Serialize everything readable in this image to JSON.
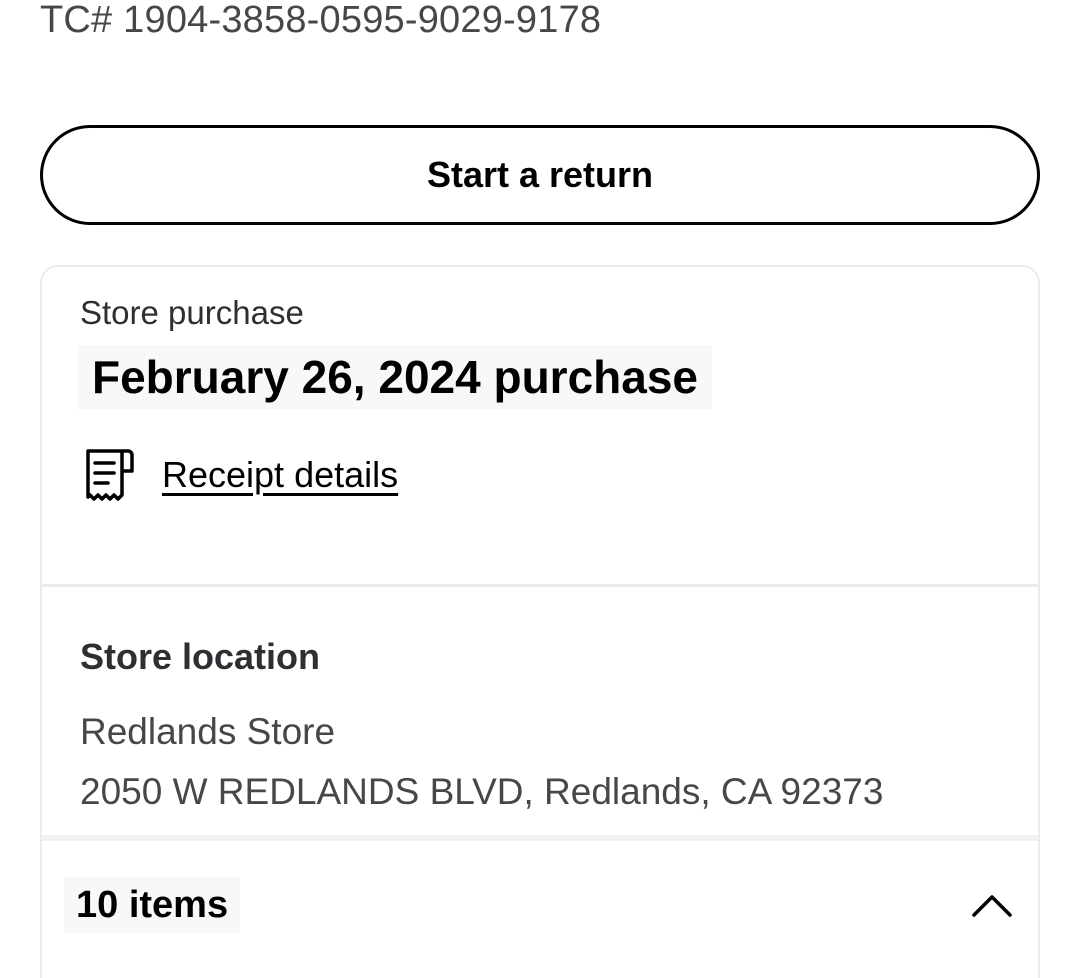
{
  "header": {
    "tc_number": "TC# 1904-3858-0595-9029-9178"
  },
  "actions": {
    "start_return_label": "Start a return"
  },
  "purchase": {
    "type": "Store purchase",
    "date_title": "February 26, 2024 purchase",
    "receipt_link": "Receipt details",
    "receipt_icon": "receipt-icon"
  },
  "location": {
    "heading": "Store location",
    "store_name": "Redlands Store",
    "address": "2050 W REDLANDS BLVD, Redlands, CA 92373"
  },
  "items": {
    "count_label": "10 items",
    "toggle_icon": "chevron-up-icon"
  }
}
